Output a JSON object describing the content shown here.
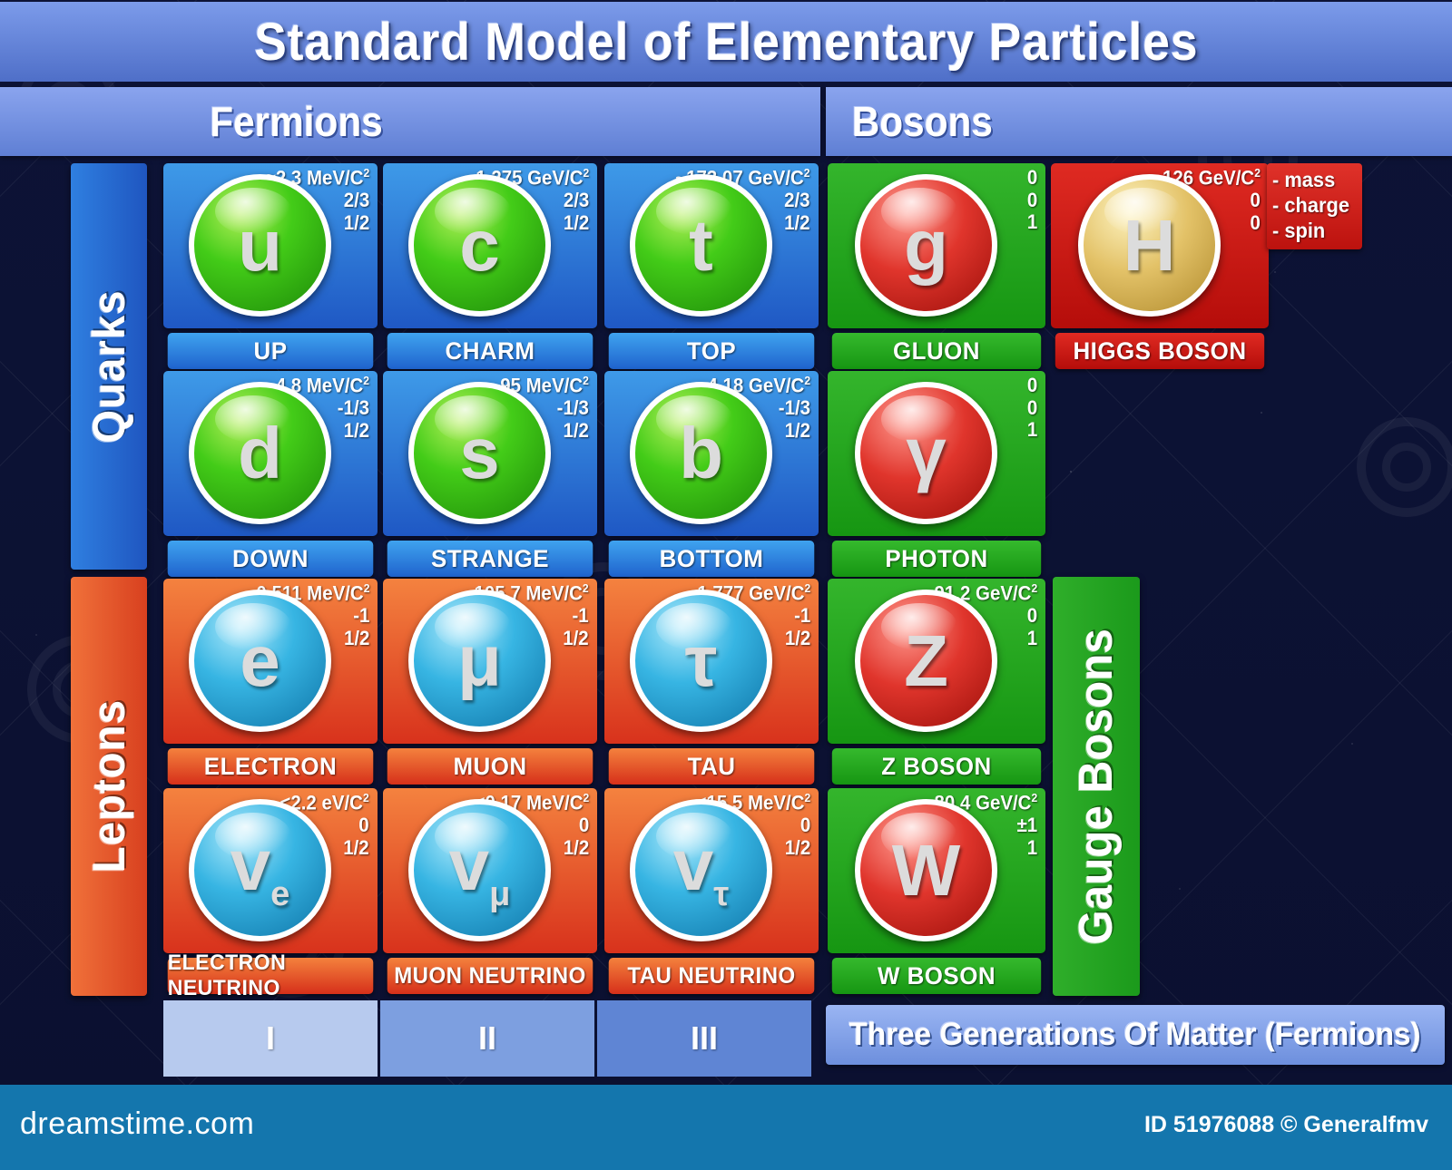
{
  "title": "Standard Model of Elementary Particles",
  "sections": {
    "fermions": "Fermions",
    "bosons": "Bosons"
  },
  "family_labels": {
    "quarks": "Quarks",
    "leptons": "Leptons",
    "gauge_bosons": "Gauge Bosons"
  },
  "legend": {
    "mass": "- mass",
    "charge": "- charge",
    "spin": "- spin"
  },
  "generations": {
    "gen1": "I",
    "gen2": "II",
    "gen3": "III",
    "caption": "Three Generations Of Matter (Fermions)"
  },
  "particles": {
    "up": {
      "symbol": "u",
      "name": "UP",
      "mass": "≈2.3 MeV/C",
      "mass_sup": "2",
      "charge": "2/3",
      "spin": "1/2"
    },
    "charm": {
      "symbol": "c",
      "name": "CHARM",
      "mass": "~1.275 GeV/C",
      "mass_sup": "2",
      "charge": "2/3",
      "spin": "1/2"
    },
    "top": {
      "symbol": "t",
      "name": "TOP",
      "mass": "~173.07 GeV/C",
      "mass_sup": "2",
      "charge": "2/3",
      "spin": "1/2"
    },
    "down": {
      "symbol": "d",
      "name": "DOWN",
      "mass": "~4.8 MeV/C",
      "mass_sup": "2",
      "charge": "-1/3",
      "spin": "1/2"
    },
    "strange": {
      "symbol": "s",
      "name": "STRANGE",
      "mass": "~95 MeV/C",
      "mass_sup": "2",
      "charge": "-1/3",
      "spin": "1/2"
    },
    "bottom": {
      "symbol": "b",
      "name": "BOTTOM",
      "mass": "~4.18 GeV/C",
      "mass_sup": "2",
      "charge": "-1/3",
      "spin": "1/2"
    },
    "electron": {
      "symbol": "e",
      "name": "ELECTRON",
      "mass": "0.511 MeV/C",
      "mass_sup": "2",
      "charge": "-1",
      "spin": "1/2"
    },
    "muon": {
      "symbol": "μ",
      "name": "MUON",
      "mass": "105.7 MeV/C",
      "mass_sup": "2",
      "charge": "-1",
      "spin": "1/2"
    },
    "tau": {
      "symbol": "τ",
      "name": "TAU",
      "mass": "~1.777 GeV/C",
      "mass_sup": "2",
      "charge": "-1",
      "spin": "1/2"
    },
    "electron_neutrino": {
      "symbol": "v",
      "sub": "e",
      "name": "ELECTRON NEUTRINO",
      "mass": "<2.2 eV/C",
      "mass_sup": "2",
      "charge": "0",
      "spin": "1/2"
    },
    "muon_neutrino": {
      "symbol": "v",
      "sub": "μ",
      "name": "MUON NEUTRINO",
      "mass": "<0.17 MeV/C",
      "mass_sup": "2",
      "charge": "0",
      "spin": "1/2"
    },
    "tau_neutrino": {
      "symbol": "v",
      "sub": "τ",
      "name": "TAU NEUTRINO",
      "mass": "<15.5 MeV/C",
      "mass_sup": "2",
      "charge": "0",
      "spin": "1/2"
    },
    "gluon": {
      "symbol": "g",
      "name": "GLUON",
      "mass": "0",
      "mass_sup": "",
      "charge": "0",
      "spin": "1"
    },
    "photon": {
      "symbol": "γ",
      "name": "PHOTON",
      "mass": "0",
      "mass_sup": "",
      "charge": "0",
      "spin": "1"
    },
    "z_boson": {
      "symbol": "Z",
      "name": "Z BOSON",
      "mass": "91.2 GeV/C",
      "mass_sup": "2",
      "charge": "0",
      "spin": "1"
    },
    "w_boson": {
      "symbol": "W",
      "name": "W BOSON",
      "mass": "80.4 GeV/C",
      "mass_sup": "2",
      "charge": "±1",
      "spin": "1"
    },
    "higgs": {
      "symbol": "H",
      "name": "HIGGS BOSON",
      "mass": "~126 GeV/C",
      "mass_sup": "2",
      "charge": "0",
      "spin": "0"
    }
  },
  "footer": {
    "brand": "dreamstime.com",
    "credit": "ID 51976088 © Generalfmv"
  },
  "colors": {
    "background": "#0d1336",
    "quark_cell": "#2f7fe0",
    "lepton_cell": "#e8521f",
    "boson_cell": "#23a81e",
    "higgs_cell": "#cf1b15",
    "header_blue": "#7c9bea",
    "footer_blue": "#1476ad"
  }
}
